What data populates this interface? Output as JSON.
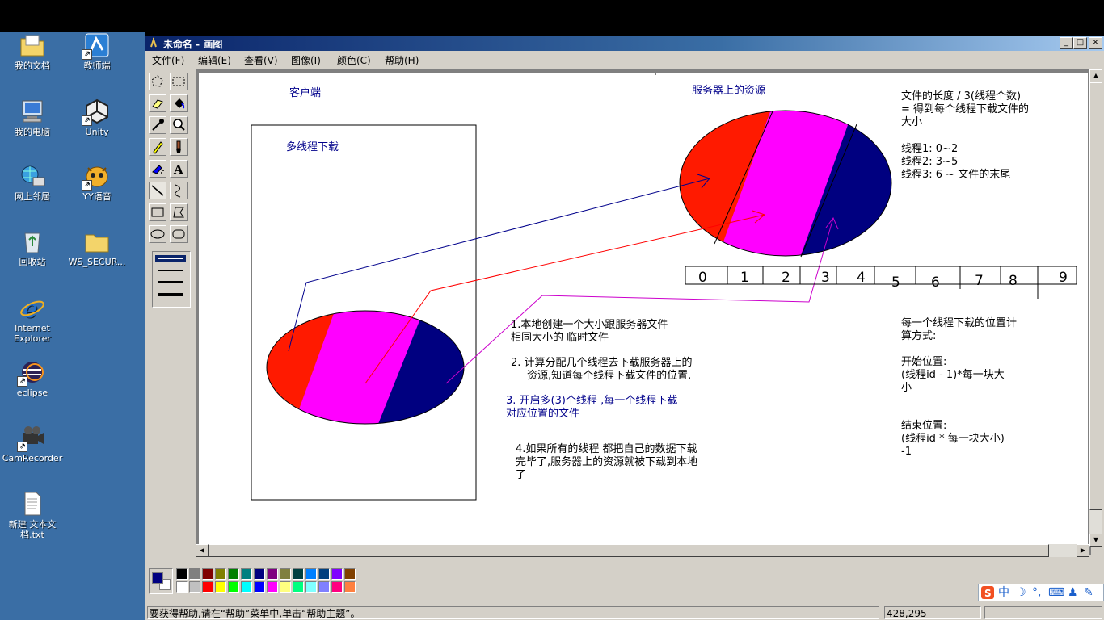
{
  "desktop": {
    "icons": [
      {
        "label": "我的文档",
        "icon": "folder-documents-icon"
      },
      {
        "label": "教师端",
        "icon": "teacher-client-icon"
      },
      {
        "label": "我的电脑",
        "icon": "computer-icon"
      },
      {
        "label": "Unity",
        "icon": "unity-icon"
      },
      {
        "label": "网上邻居",
        "icon": "network-icon"
      },
      {
        "label": "YY语音",
        "icon": "yy-voice-icon"
      },
      {
        "label": "回收站",
        "icon": "recycle-bin-icon"
      },
      {
        "label": "WS_SECUR...",
        "icon": "folder-icon"
      },
      {
        "label": "Internet Explorer",
        "icon": "internet-explorer-icon"
      },
      {
        "label": "eclipse",
        "icon": "eclipse-icon"
      },
      {
        "label": "CamRecorder",
        "icon": "camrecorder-icon"
      },
      {
        "label": "新建 文本文档.txt",
        "icon": "text-file-icon"
      }
    ]
  },
  "window": {
    "title": "未命名 - 画图",
    "controls": {
      "minimize": "_",
      "maximize": "□",
      "close": "×"
    }
  },
  "menu": [
    "文件(F)",
    "编辑(E)",
    "查看(V)",
    "图像(I)",
    "颜色(C)",
    "帮助(H)"
  ],
  "tools": [
    "free-select",
    "rect-select",
    "eraser",
    "fill",
    "color-picker",
    "magnifier",
    "pencil",
    "brush",
    "airbrush",
    "text",
    "line",
    "curve",
    "rectangle",
    "polygon",
    "ellipse",
    "rounded-rectangle"
  ],
  "selected_tool": "line",
  "drawing": {
    "texts": {
      "client": "客户端",
      "multi_thread": "多线程下载",
      "server_resource": "服务器上的资源",
      "file_len_1": "文件的长度 / 3(线程个数)",
      "file_len_2": "= 得到每个线程下载文件的",
      "file_len_3": "大小",
      "thread1": "线程1: 0~2",
      "thread2": "线程2: 3~5",
      "thread3": "线程3: 6 ~ 文件的末尾",
      "step1_a": "1.本地创建一个大小跟服务器文件",
      "step1_b": "相同大小的 临时文件",
      "step2_a": "2. 计算分配几个线程去下载服务器上的",
      "step2_b": "资源,知道每个线程下载文件的位置.",
      "step3_a": "3.  开启多(3)个线程 ,每一个线程下载",
      "step3_b": "对应位置的文件",
      "step4_a": "4.如果所有的线程 都把自己的数据下载",
      "step4_b": "完毕了,服务器上的资源就被下载到本地",
      "step4_c": "了",
      "pos_calc_1": "每一个线程下载的位置计",
      "pos_calc_2": "算方式:",
      "start_1": "开始位置:",
      "start_2": "(线程id - 1)*每一块大",
      "start_3": "小",
      "end_1": "结束位置:",
      "end_2": "(线程id * 每一块大小)",
      "end_3": "-1"
    },
    "number_line": [
      "0",
      "1",
      "2",
      "3",
      "4",
      "5",
      "6",
      "7",
      "8",
      "9"
    ]
  },
  "palette": {
    "foreground": "#000080",
    "background": "#ffffff",
    "top_row": [
      "#000000",
      "#808080",
      "#800000",
      "#808000",
      "#008000",
      "#008080",
      "#000080",
      "#800080",
      "#808040",
      "#004040",
      "#0080ff",
      "#004080",
      "#8000ff",
      "#804000"
    ],
    "bottom_row": [
      "#ffffff",
      "#c0c0c0",
      "#ff0000",
      "#ffff00",
      "#00ff00",
      "#00ffff",
      "#0000ff",
      "#ff00ff",
      "#ffff80",
      "#00ff80",
      "#80ffff",
      "#8080ff",
      "#ff0080",
      "#ff8040"
    ]
  },
  "status": {
    "message": "要获得帮助,请在“帮助”菜单中,单击“帮助主题”。",
    "coords": "428,295"
  },
  "ime": {
    "label": "中"
  }
}
